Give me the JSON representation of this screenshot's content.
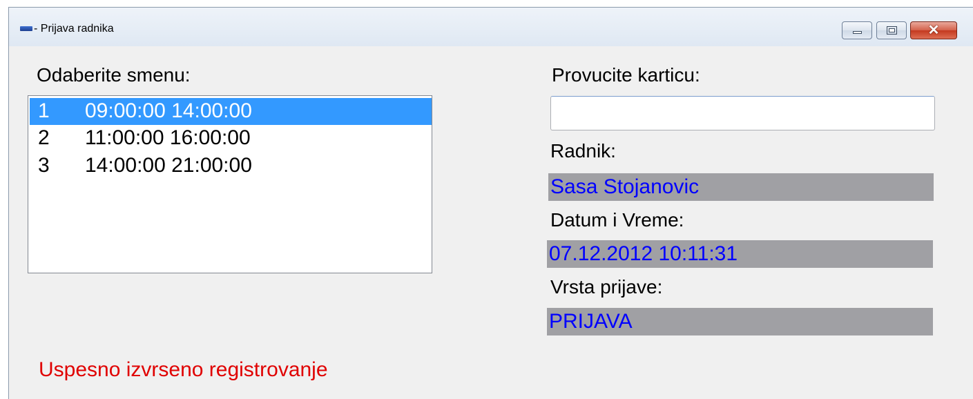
{
  "window": {
    "title": "- Prijava radnika",
    "controls": {
      "minimize": "minimize",
      "maximize": "maximize",
      "close": "✕"
    }
  },
  "shift_section": {
    "label": "Odaberite smenu:",
    "shifts": [
      {
        "num": "1",
        "time": "09:00:00 14:00:00",
        "selected": true
      },
      {
        "num": "2",
        "time": "11:00:00 16:00:00",
        "selected": false
      },
      {
        "num": "3",
        "time": "14:00:00 21:00:00",
        "selected": false
      }
    ]
  },
  "card_section": {
    "label": "Provucite karticu:",
    "input_value": ""
  },
  "worker": {
    "label": "Radnik:",
    "value": "Sasa Stojanovic"
  },
  "datetime": {
    "label": "Datum i Vreme:",
    "value": "07.12.2012 10:11:31"
  },
  "entry_type": {
    "label": "Vrsta prijave:",
    "value": "PRIJAVA"
  },
  "status_message": "Uspesno izvrseno registrovanje",
  "colors": {
    "selection": "#3399ff",
    "value_background": "#a0a0a4",
    "value_text": "#0000ff",
    "status_text": "#e00000"
  }
}
